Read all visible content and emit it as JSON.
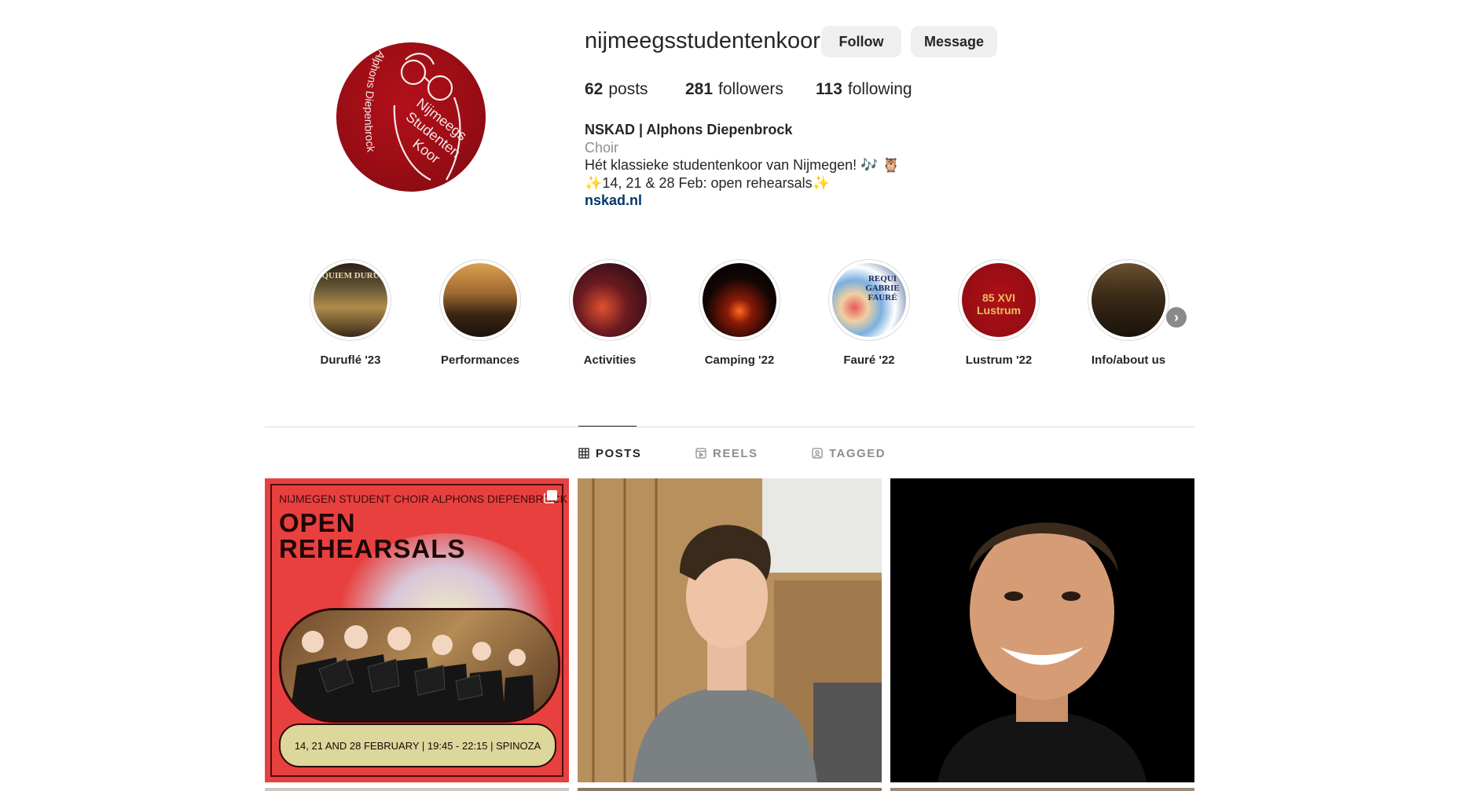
{
  "profile": {
    "username": "nijmeegsstudentenkoor",
    "follow_label": "Follow",
    "message_label": "Message",
    "avatar_text_outer": "Alphons Diepenbrock",
    "avatar_text_inner": [
      "Nijmeegs",
      "Studenten",
      "Koor"
    ]
  },
  "stats": {
    "posts_count": "62",
    "posts_label": "posts",
    "followers_count": "281",
    "followers_label": "followers",
    "following_count": "113",
    "following_label": "following"
  },
  "bio": {
    "name": "NSKAD | Alphons Diepenbrock",
    "category": "Choir",
    "line1": "Hét klassieke studentenkoor van Nijmegen! 🎶 🦉",
    "line2": "✨14, 21 & 28 Feb: open rehearsals✨",
    "link": "nskad.nl"
  },
  "highlights": [
    {
      "label": "Duruflé '23",
      "thumb_text": "QUIEM DURU"
    },
    {
      "label": "Performances"
    },
    {
      "label": "Activities"
    },
    {
      "label": "Camping '22"
    },
    {
      "label": "Fauré '22",
      "thumb_text": "REQUI GABRIE FAURÉ"
    },
    {
      "label": "Lustrum '22",
      "thumb_text": "85 XVI Lustrum"
    },
    {
      "label": "Info/about us"
    }
  ],
  "tabs": [
    {
      "label": "POSTS",
      "icon": "grid-icon",
      "active": true
    },
    {
      "label": "REELS",
      "icon": "reels-icon",
      "active": false
    },
    {
      "label": "TAGGED",
      "icon": "tagged-icon",
      "active": false
    }
  ],
  "posts": {
    "post1": {
      "top_text": "NIJMEGEN STUDENT CHOIR ALPHONS DIEPENBROCK",
      "title_line1": "OPEN",
      "title_line2": "REHEARSALS",
      "pill_text": "14, 21 AND 28 FEBRUARY | 19:45 - 22:15 | SPINOZA"
    }
  },
  "colors": {
    "button_bg": "#efefef",
    "link": "#00376b",
    "secondary_text": "#8e8e8e",
    "avatar_red": "#9a0d15"
  }
}
